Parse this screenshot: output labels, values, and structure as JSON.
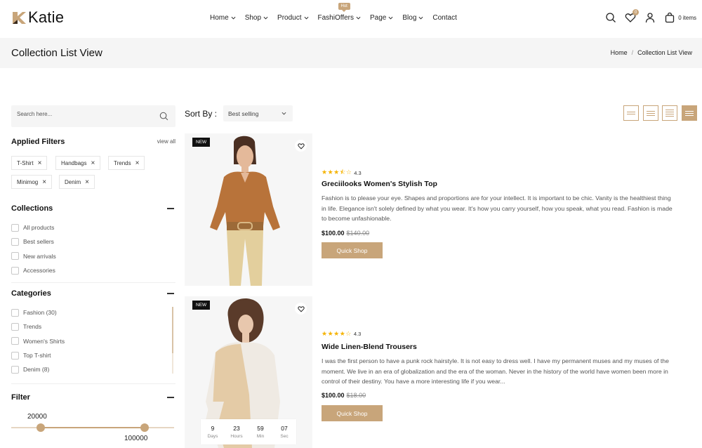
{
  "brand": {
    "name": "Katie",
    "accent": "#c8a57a"
  },
  "nav": {
    "items": [
      {
        "label": "Home",
        "has_dropdown": true
      },
      {
        "label": "Shop",
        "has_dropdown": true
      },
      {
        "label": "Product",
        "has_dropdown": true
      },
      {
        "label": "FashiOffers",
        "has_dropdown": true,
        "badge": "Hot"
      },
      {
        "label": "Page",
        "has_dropdown": true
      },
      {
        "label": "Blog",
        "has_dropdown": true
      },
      {
        "label": "Contact",
        "has_dropdown": false
      }
    ]
  },
  "header_icons": {
    "search": "search-icon",
    "wishlist": "heart-icon",
    "wishlist_count": "0",
    "account": "user-icon",
    "cart": "bag-icon",
    "cart_text": "0 items"
  },
  "page": {
    "title": "Collection List View",
    "breadcrumb": [
      "Home",
      "Collection List View"
    ]
  },
  "sidebar": {
    "search_placeholder": "Search here...",
    "applied_filters": {
      "title": "Applied Filters",
      "view_all": "view all",
      "tags": [
        "T-Shirt",
        "Handbags",
        "Trends",
        "Minimog",
        "Denim"
      ]
    },
    "collections": {
      "title": "Collections",
      "items": [
        "All products",
        "Best sellers",
        "New arrivals",
        "Accessories"
      ]
    },
    "categories": {
      "title": "Categories",
      "items": [
        "Fashion (30)",
        "Trends",
        "Women's Shirts",
        "Top T-shirt",
        "Denim (8)"
      ]
    },
    "filter": {
      "title": "Filter",
      "min": "20000",
      "max": "100000"
    }
  },
  "toolbar": {
    "sort_label": "Sort By :",
    "sort_value": "Best selling"
  },
  "products": [
    {
      "badge": "NEW",
      "rating": 3.5,
      "rating_text": "4.3",
      "name": "Greciilooks Women's Stylish Top",
      "description": "Fashion is to please your eye. Shapes and proportions are for your intellect. It is important to be chic. Vanity is the healthiest thing in life. Elegance isn't solely defined by what you wear. It's how you carry yourself, how you speak, what you read. Fashion is made to become unfashionable.",
      "price": "$100.00",
      "old_price": "$140.00",
      "button": "Quick Shop"
    },
    {
      "badge": "NEW",
      "rating": 4,
      "rating_text": "4.3",
      "name": "Wide Linen-Blend Trousers",
      "description": "I was the first person to have a punk rock hairstyle. It is not easy to dress well. I have my permanent muses and my muses of the moment. We live in an era of globalization and the era of the woman. Never in the history of the world have women been more in control of their destiny. You have a more interesting life if you wear...",
      "price": "$100.00",
      "old_price": "$18.00",
      "button": "Quick Shop",
      "countdown": [
        {
          "value": "9",
          "label": "Days"
        },
        {
          "value": "23",
          "label": "Hours"
        },
        {
          "value": "59",
          "label": "Min"
        },
        {
          "value": "07",
          "label": "Sec"
        }
      ]
    }
  ]
}
